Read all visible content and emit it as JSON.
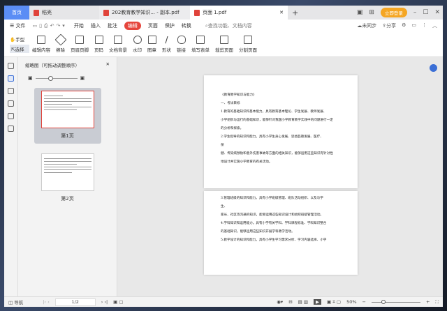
{
  "tabs": [
    {
      "label": "首页"
    },
    {
      "label": "稻壳"
    },
    {
      "label": "202教育教学知识... - 副本.pdf"
    },
    {
      "label": "页面 1.pdf"
    }
  ],
  "login": "立即登录",
  "menu": {
    "file": "文件",
    "items": [
      "开始",
      "插入",
      "批注",
      "编辑",
      "页面",
      "保护",
      "转换"
    ],
    "search": "查找功能、文档内容",
    "sync": "未同步",
    "share": "分享"
  },
  "toolbar": {
    "hand": "手型",
    "select": "选择",
    "items": [
      "编辑内容",
      "擦除",
      "页眉页脚",
      "页码",
      "文档背景",
      "水印",
      "图章",
      "形状",
      "链接",
      "填写表单",
      "裁剪页面",
      "分割页面"
    ]
  },
  "thumbs": {
    "title": "缩略图（可拖动调整顺序）",
    "pages": [
      "第1页",
      "第2页"
    ]
  },
  "page1": [
    "《教育教学知识与能力》",
    "一、考试目标",
    "1.教育的基础知识和基本能力。具有教育基本理论、学生发展、教师发展、",
    "小学组织与运行的基础知识，能够针对我国小学教育教学实践中的问题进行一定",
    "的分析和探索。",
    "2.学生指导的知识和能力。具有小学生身心发展、思想品德发展、医疗、",
    "保",
    "健、传染病预防和意外伤害事故等方面的相关知识，能够运用这些知识有针对性",
    "地设计并实施小学教育的有关活动。"
  ],
  "page2": [
    "3.管理班级的知识和能力。具有小学班级管理、班队活动组织、以及与学",
    "生、",
    "家长、社区等沟通的知识，能够运用这些知识设计和组织班级管理活动。",
    "4.学科知识和运用能力。具有小学有关学科、学科课程标准、学科知识整合",
    "的基础知识，能够运用这些知识开展学科教学活动。",
    "5.教学设计的知识和能力。具有小学生学习需求分析、学习内容选择、小学"
  ],
  "status": {
    "nav": "导航",
    "page": "1/2",
    "zoom": "50%"
  }
}
